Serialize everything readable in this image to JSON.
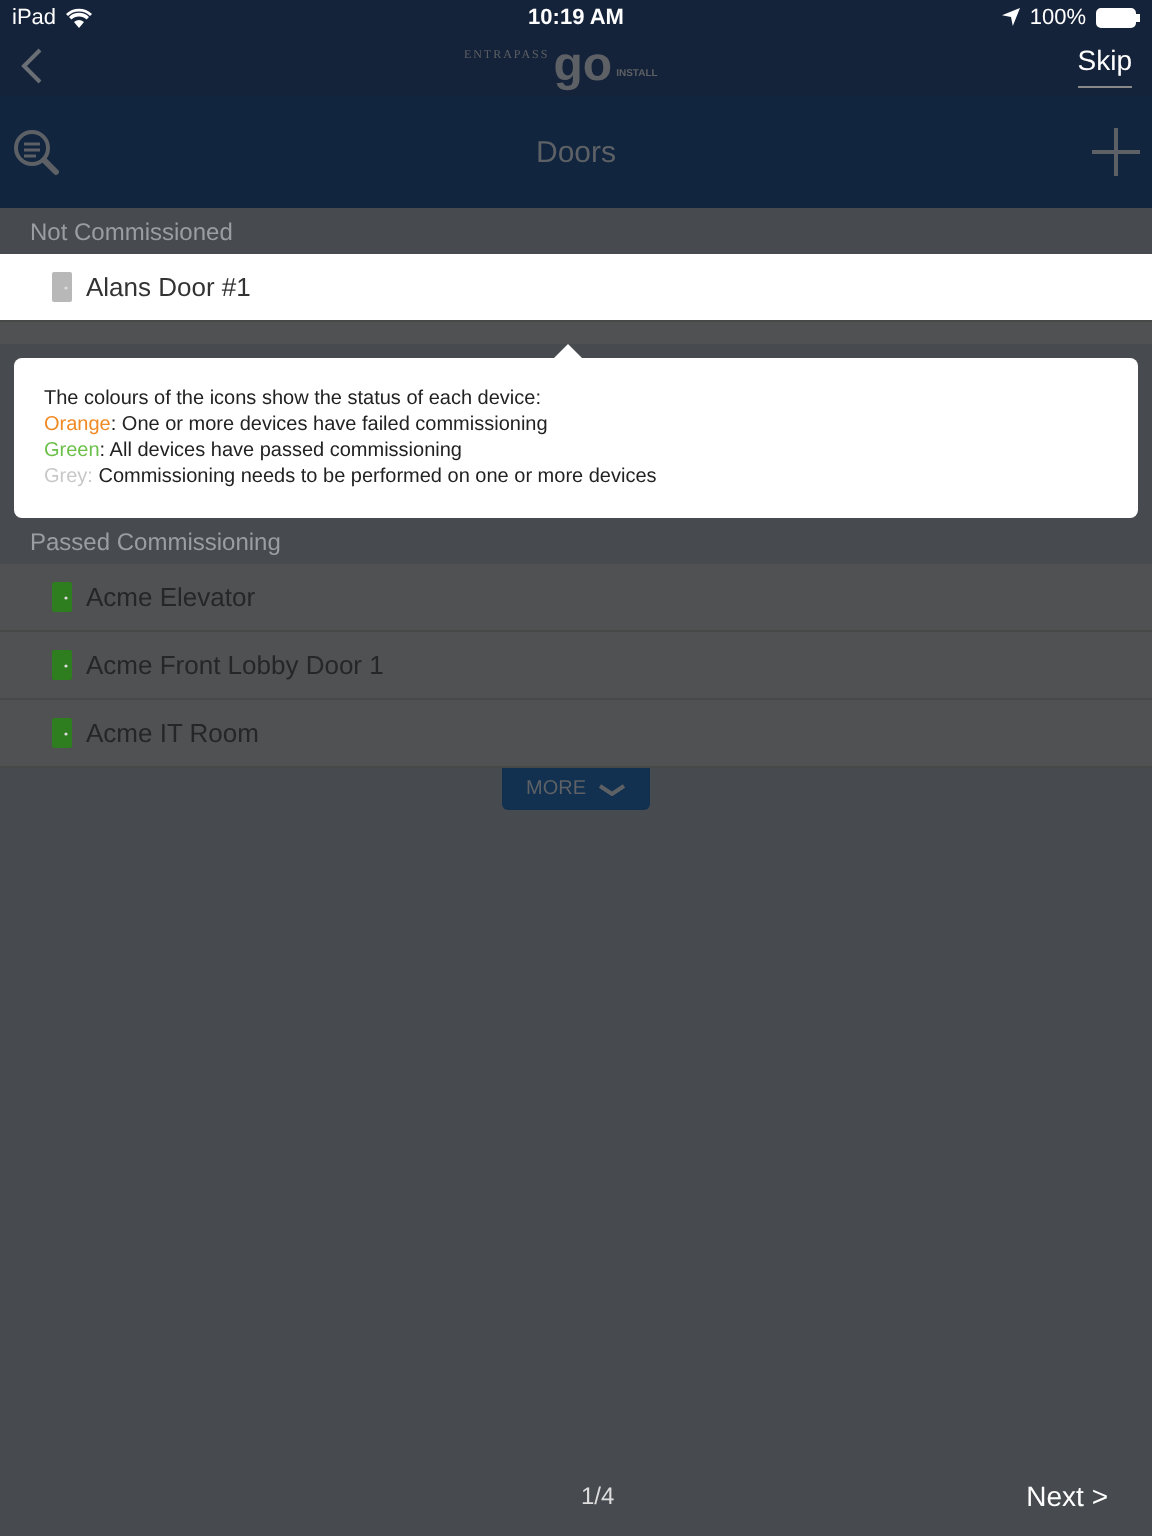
{
  "status_bar": {
    "carrier": "iPad",
    "time": "10:19 AM",
    "battery": "100%"
  },
  "nav": {
    "logo_left": "ENTRAPASS",
    "logo_main": "go",
    "logo_right": "INSTALL",
    "skip": "Skip"
  },
  "toolbar": {
    "title": "Doors"
  },
  "sections": [
    {
      "title": "Not Commissioned",
      "items": [
        {
          "name": "Alans Door #1",
          "color": "#b8b8b8",
          "selected": true
        }
      ]
    },
    {
      "title": "Passed Commissioning",
      "items": [
        {
          "name": "Acme Elevator",
          "color": "#2e7d1f",
          "selected": false
        },
        {
          "name": "Acme Front Lobby Door 1",
          "color": "#2e7d1f",
          "selected": false
        },
        {
          "name": "Acme IT Room",
          "color": "#2e7d1f",
          "selected": false
        }
      ]
    }
  ],
  "more": "MORE",
  "tooltip": {
    "intro": "The colours of the icons show the status of each device:",
    "legend": [
      {
        "label": "Orange",
        "color": "#f08a24",
        "text": ": One or more devices have failed commissioning"
      },
      {
        "label": "Green",
        "color": "#6cc04a",
        "text": ": All devices have passed commissioning"
      },
      {
        "label": "Grey:",
        "color": "#c8c8c8",
        "text": " Commissioning needs to be performed on one or more devices"
      }
    ]
  },
  "footer": {
    "page": "1/4",
    "next": "Next >"
  }
}
